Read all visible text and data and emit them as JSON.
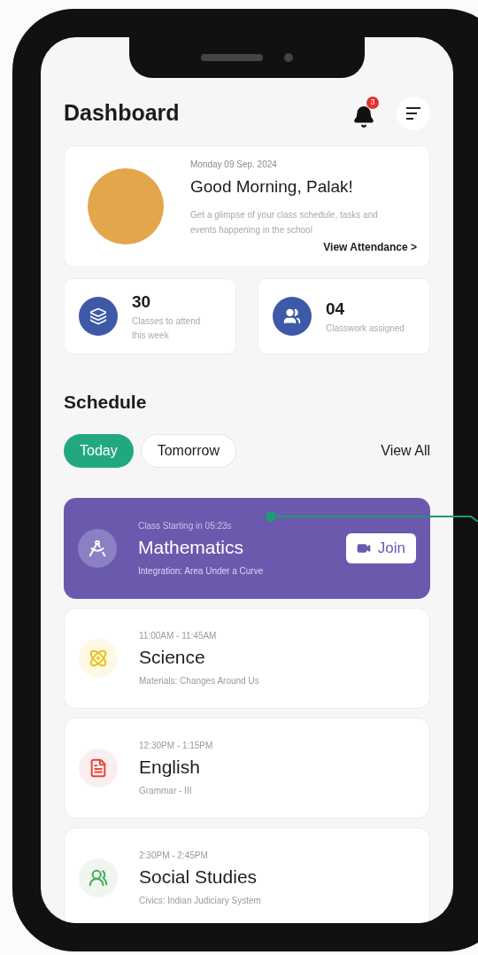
{
  "header": {
    "title": "Dashboard",
    "notification_count": "3"
  },
  "greeting": {
    "date": "Monday 09 Sep. 2024",
    "title": "Good Morning, Palak!",
    "description": "Get a glimpse of your class schedule, tasks and events happening in the school",
    "link": "View Attendance >"
  },
  "stats": [
    {
      "kind": "classes",
      "value": "30",
      "label": "Classes to attend this week"
    },
    {
      "kind": "classwork",
      "value": "04",
      "label": "Classwork assigned"
    }
  ],
  "schedule": {
    "title": "Schedule",
    "tabs": [
      {
        "label": "Today",
        "selected": true
      },
      {
        "label": "Tomorrow",
        "selected": false
      }
    ],
    "view_all": "View All",
    "classes": [
      {
        "kind": "math",
        "live": true,
        "time": "Class Starting in 05:23s",
        "name": "Mathematics",
        "topic": "Integration: Area Under a Curve",
        "button": "Join",
        "color": "#ffffff"
      },
      {
        "kind": "science",
        "live": false,
        "time": "11:00AM - 11:45AM",
        "name": "Science",
        "topic": "Materials: Changes Around Us",
        "color": "#e8c21e"
      },
      {
        "kind": "english",
        "live": false,
        "time": "12:30PM - 1:15PM",
        "name": "English",
        "topic": "Grammar - III",
        "color": "#e5463b"
      },
      {
        "kind": "social",
        "live": false,
        "time": "2:30PM - 2:45PM",
        "name": "Social Studies",
        "topic": "Civics: Indian Judiciary System",
        "color": "#3fae5a"
      }
    ]
  }
}
